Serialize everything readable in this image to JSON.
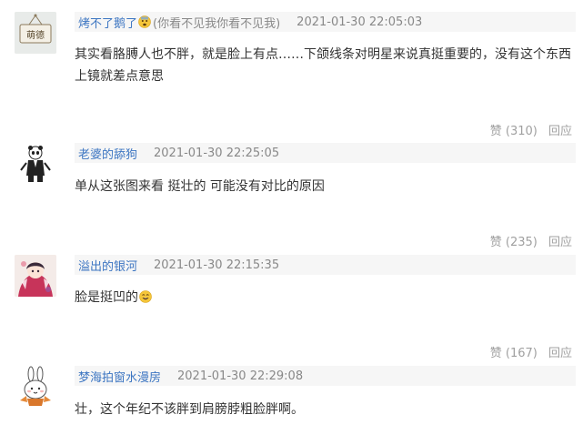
{
  "comments": [
    {
      "username": "烤不了鹅了",
      "username_extra": "(你看不见我你看不见我)",
      "timestamp": "2021-01-30 22:05:03",
      "text": "其实看胳膊人也不胖，就是脸上有点……下颌线条对明星来说真挺重要的，没有这个东西上镜就差点意思",
      "like_label": "赞",
      "like_count": "(310)",
      "reply_label": "回应",
      "avatar_text": "萌德"
    },
    {
      "username": "老婆的舔狗",
      "timestamp": "2021-01-30 22:25:05",
      "text": "单从这张图来看 挺壮的 可能没有对比的原因",
      "like_label": "赞",
      "like_count": "(235)",
      "reply_label": "回应"
    },
    {
      "username": "溢出的银河",
      "timestamp": "2021-01-30 22:15:35",
      "text": "脸是挺凹的",
      "like_label": "赞",
      "like_count": "(167)",
      "reply_label": "回应"
    },
    {
      "username": "梦海拍窗水漫房",
      "timestamp": "2021-01-30 22:29:08",
      "text": "壮，这个年纪不该胖到肩膀脖粗脸胖啊。"
    }
  ]
}
